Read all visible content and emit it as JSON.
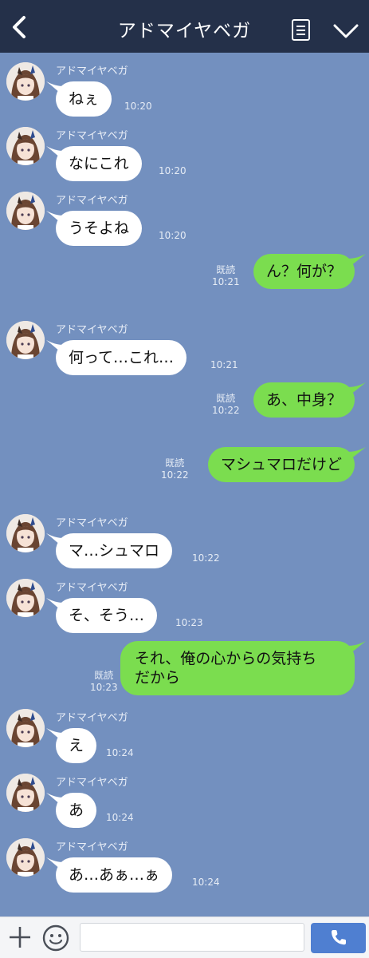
{
  "header": {
    "title": "アドマイヤベガ",
    "back_icon": "chevron-left-icon",
    "menu_icon": "note-list-icon",
    "expand_icon": "chevron-down-icon"
  },
  "messages": [
    {
      "side": "in",
      "sender": "アドマイヤベガ",
      "text": "ねぇ",
      "time": "10:20"
    },
    {
      "side": "in",
      "sender": "アドマイヤベガ",
      "text": "なにこれ",
      "time": "10:20"
    },
    {
      "side": "in",
      "sender": "アドマイヤベガ",
      "text": "うそよね",
      "time": "10:20"
    },
    {
      "side": "out",
      "text": "ん？何が？",
      "read": "既読",
      "time": "10:21"
    },
    {
      "side": "in",
      "sender": "アドマイヤベガ",
      "text": "何って…これ…",
      "time": "10:21"
    },
    {
      "side": "out",
      "text": "あ、中身？",
      "read": "既読",
      "time": "10:22"
    },
    {
      "side": "out",
      "text": "マシュマロだけど",
      "read": "既読",
      "time": "10:22"
    },
    {
      "side": "in",
      "sender": "アドマイヤベガ",
      "text": "マ…シュマロ",
      "time": "10:22"
    },
    {
      "side": "in",
      "sender": "アドマイヤベガ",
      "text": "そ、そう…",
      "time": "10:23"
    },
    {
      "side": "out",
      "text_lines": [
        "それ、俺の心からの気持ち",
        "だから"
      ],
      "read": "既読",
      "time": "10:23"
    },
    {
      "side": "in",
      "sender": "アドマイヤベガ",
      "text": "え",
      "time": "10:24"
    },
    {
      "side": "in",
      "sender": "アドマイヤベガ",
      "text": "あ",
      "time": "10:24"
    },
    {
      "side": "in",
      "sender": "アドマイヤベガ",
      "text": "あ…あぁ…ぁ",
      "time": "10:24"
    }
  ],
  "footer": {
    "plus_icon": "plus-icon",
    "emoji_icon": "smiley-icon",
    "input_placeholder": "",
    "call_icon": "phone-icon"
  },
  "colors": {
    "header_bg": "#243049",
    "chat_bg": "#7390bf",
    "outgoing_bubble": "#7bdd4f",
    "incoming_bubble": "#ffffff",
    "call_button": "#4f7fd1"
  }
}
